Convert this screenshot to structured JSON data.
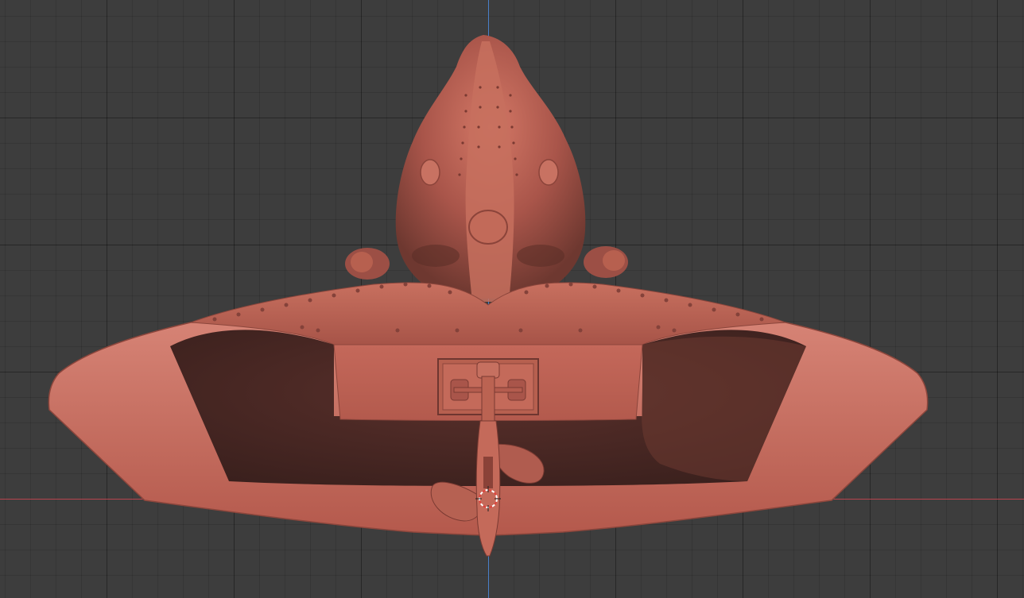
{
  "viewport": {
    "view": "3d-viewport-front-orthographic",
    "background_color": "#3d3d3d",
    "x_axis_color": "#b8444e",
    "z_axis_color": "#4a7fc8",
    "model_color": "#c46a5c"
  },
  "scene": {
    "object": "submarine-model",
    "components": [
      "hull-dome",
      "flared-skirt",
      "rear-plate",
      "shaft-bracket",
      "propeller",
      "rudder",
      "3d-cursor"
    ]
  }
}
